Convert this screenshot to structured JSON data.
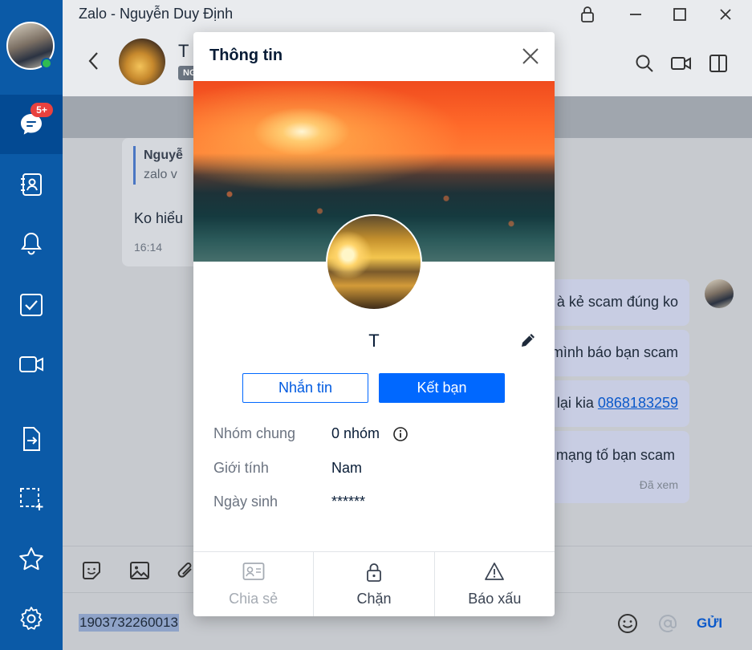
{
  "window": {
    "title": "Zalo - Nguyễn Duy Định"
  },
  "nav": {
    "badge": "5+"
  },
  "chat": {
    "name": "T",
    "tag": "NG",
    "messages": [
      {
        "quote_author": "Nguyễ",
        "quote_text": "zalo v",
        "text": "Ko hiểu",
        "time": "16:14"
      },
      {
        "text": "à kẻ scam đúng ko"
      },
      {
        "text": "mình báo bạn scam"
      },
      {
        "text": "lại kia ",
        "link": "0868183259"
      },
      {
        "text": "mạng tố bạn scam",
        "status": "Đã xem"
      }
    ]
  },
  "composer": {
    "typed": "1903732260013",
    "send_label": "GỬI"
  },
  "modal": {
    "title": "Thông tin",
    "name": "T",
    "message_button": "Nhắn tin",
    "add_friend_button": "Kết bạn",
    "fields": [
      {
        "label": "Nhóm chung",
        "value": "0 nhóm"
      },
      {
        "label": "Giới tính",
        "value": "Nam"
      },
      {
        "label": "Ngày sinh",
        "value": "******"
      }
    ],
    "footer": {
      "share": "Chia sẻ",
      "block": "Chặn",
      "report": "Báo xấu"
    }
  },
  "colors": {
    "nav": "#0b5aa7",
    "primary": "#0068ff",
    "badge": "#e9413e"
  }
}
